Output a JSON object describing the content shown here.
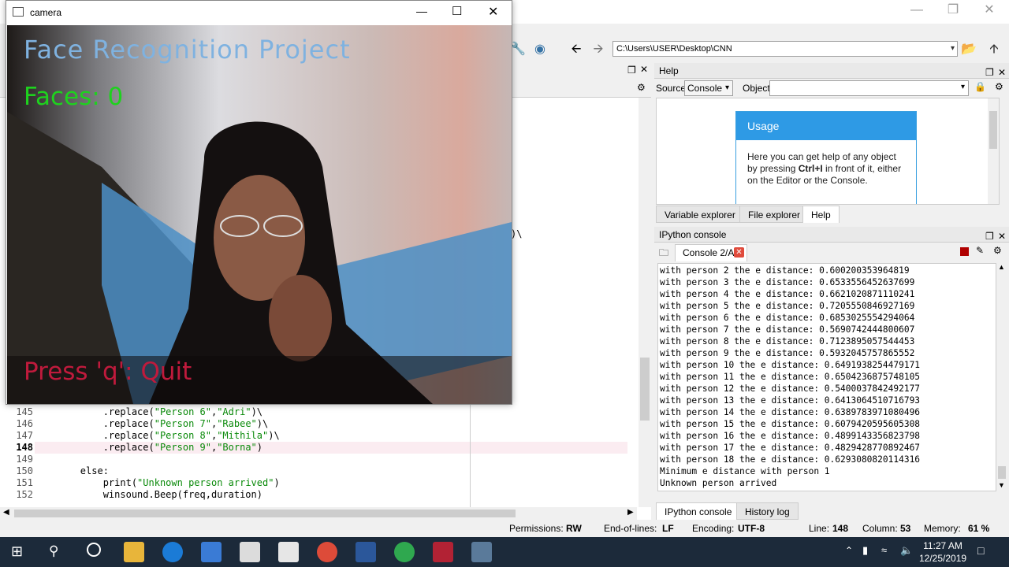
{
  "camera_window": {
    "title": "camera",
    "overlay_title": "Face Recognition Project",
    "faces_label": "Faces: 0",
    "quit_label": "Press 'q': Quit",
    "colors": {
      "title": "#7fb2e0",
      "faces": "#1ed21e",
      "quit": "#c01a3c"
    }
  },
  "toolbar": {
    "path": "C:\\Users\\USER\\Desktop\\CNN"
  },
  "editor": {
    "lines": [
      {
        "num": "145",
        "pre": "            .replace(",
        "s1": "\"Person 6\"",
        "mid": ",",
        "s2": "\"Adri\"",
        "post": ")\\"
      },
      {
        "num": "146",
        "pre": "            .replace(",
        "s1": "\"Person 7\"",
        "mid": ",",
        "s2": "\"Rabee\"",
        "post": ")\\"
      },
      {
        "num": "147",
        "pre": "            .replace(",
        "s1": "\"Person 8\"",
        "mid": ",",
        "s2": "\"Mithila\"",
        "post": ")\\"
      },
      {
        "num": "148",
        "pre": "            .replace(",
        "s1": "\"Person 9\"",
        "mid": ",",
        "s2": "\"Borna\"",
        "post": ")"
      },
      {
        "num": "149",
        "pre": "",
        "s1": "",
        "mid": "",
        "s2": "",
        "post": ""
      },
      {
        "num": "150",
        "pre": "        else:",
        "s1": "",
        "mid": "",
        "s2": "",
        "post": ""
      },
      {
        "num": "151",
        "pre": "            print(",
        "s1": "\"Unknown person arrived\"",
        "mid": "",
        "s2": "",
        "post": ")"
      },
      {
        "num": "152",
        "pre": "            winsound.Beep(freq,duration)",
        "s1": "",
        "mid": "",
        "s2": "",
        "post": ""
      }
    ],
    "stray_text": ")\\"
  },
  "help": {
    "title": "Help",
    "source_label": "Source",
    "source_value": "Console",
    "object_label": "Object",
    "usage_title": "Usage",
    "usage_text_1": "Here you can get help of any object by pressing ",
    "usage_key": "Ctrl+I",
    "usage_text_2": " in front of it, either on the Editor or the Console.",
    "tabs": [
      "Variable explorer",
      "File explorer",
      "Help"
    ]
  },
  "console": {
    "title": "IPython console",
    "tab_label": "Console 2/A",
    "lines": [
      "with person 2 the e distance: 0.600200353964819",
      "with person 3 the e distance: 0.6533556452637699",
      "with person 4 the e distance: 0.6621020871110241",
      "with person 5 the e distance: 0.7205550846927169",
      "with person 6 the e distance: 0.6853025554294064",
      "with person 7 the e distance: 0.5690742444800607",
      "with person 8 the e distance: 0.7123895057544453",
      "with person 9 the e distance: 0.5932045757865552",
      "with person 10 the e distance: 0.6491938254479171",
      "with person 11 the e distance: 0.6504236875748105",
      "with person 12 the e distance: 0.5400037842492177",
      "with person 13 the e distance: 0.6413064510716793",
      "with person 14 the e distance: 0.6389783971080496",
      "with person 15 the e distance: 0.6079420595605308",
      "with person 16 the e distance: 0.4899143356823798",
      "with person 17 the e distance: 0.4829428770892467",
      "with person 18 the e distance: 0.6293080820114316",
      "Minimum e distance with person 1",
      "Unknown person arrived"
    ],
    "tabs": [
      "IPython console",
      "History log"
    ]
  },
  "statusbar": {
    "permissions_label": "Permissions:",
    "permissions": "RW",
    "eol_label": "End-of-lines:",
    "eol": "LF",
    "encoding_label": "Encoding:",
    "encoding": "UTF-8",
    "line_label": "Line:",
    "line": "148",
    "column_label": "Column:",
    "column": "53",
    "memory_label": "Memory:",
    "memory": "61 %"
  },
  "taskbar": {
    "time": "11:27 AM",
    "date": "12/25/2019"
  }
}
